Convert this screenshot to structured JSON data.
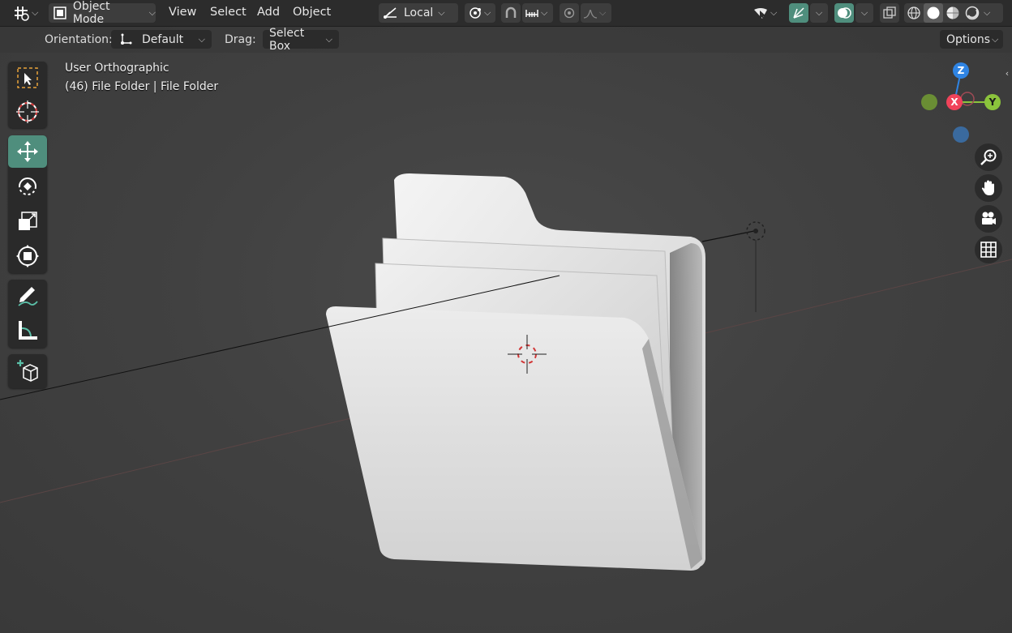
{
  "header": {
    "mode_label": "Object Mode",
    "menus": [
      "View",
      "Select",
      "Add",
      "Object"
    ],
    "transform_orientation": "Local"
  },
  "tool_settings": {
    "orientation_label": "Orientation:",
    "orientation_value": "Default",
    "drag_label": "Drag:",
    "drag_value": "Select Box",
    "options_label": "Options"
  },
  "viewport": {
    "view_name": "User Orthographic",
    "object_info": "(46) File Folder | File Folder"
  },
  "gizmo": {
    "z_label": "Z",
    "y_label": "Y",
    "x_label": "X",
    "colors": {
      "x": "#f0435a",
      "y": "#8bc33c",
      "z": "#2f84e3"
    }
  },
  "colors": {
    "accent": "#4f8e7d",
    "header_bg": "#2c2c2c",
    "viewport_bg": "#404040"
  },
  "icons": {
    "editor_type": "grid-editor-icon",
    "tools": [
      "select-box-icon",
      "cursor-icon",
      "move-icon",
      "rotate-icon",
      "scale-icon",
      "transform-icon",
      "annotate-icon",
      "measure-icon",
      "add-cube-icon"
    ],
    "nav": [
      "zoom-icon",
      "pan-hand-icon",
      "camera-icon",
      "grid-view-icon"
    ]
  }
}
